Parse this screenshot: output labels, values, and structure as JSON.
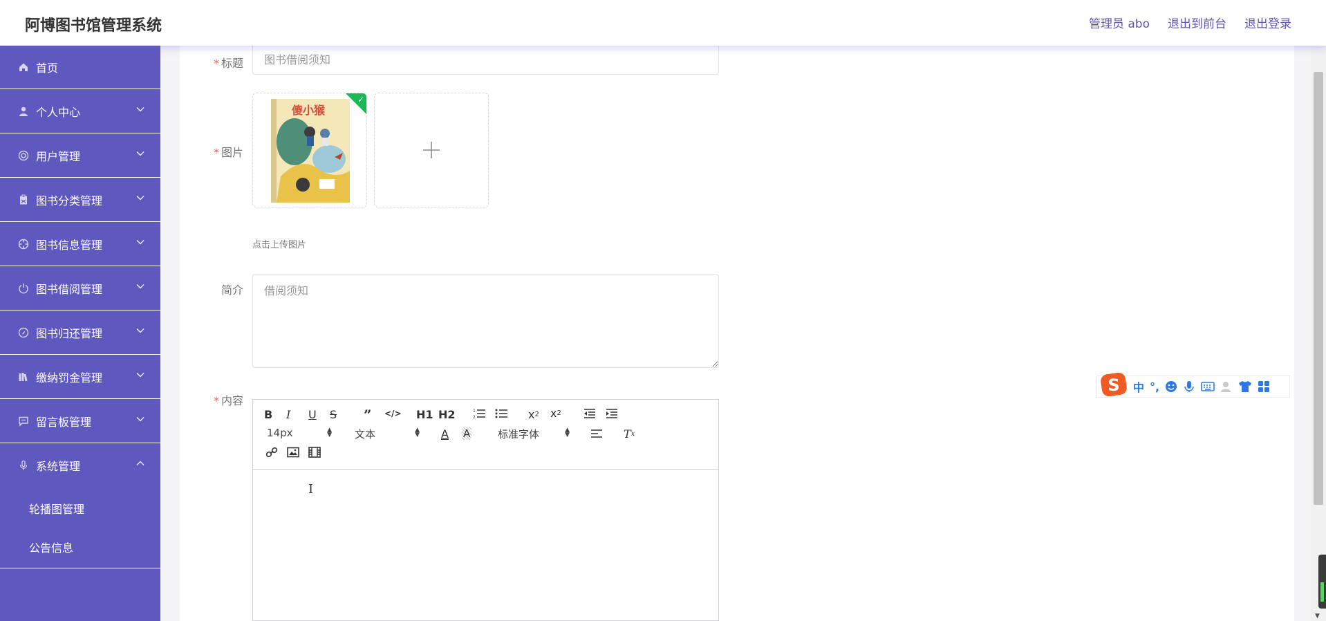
{
  "header": {
    "title": "阿博图书馆管理系统",
    "admin_label": "管理员 abo",
    "front_label": "退出到前台",
    "logout_label": "退出登录"
  },
  "sidebar": {
    "items": [
      {
        "label": "首页",
        "icon": "home-icon"
      },
      {
        "label": "个人中心",
        "icon": "user-icon"
      },
      {
        "label": "用户管理",
        "icon": "users-circle-icon"
      },
      {
        "label": "图书分类管理",
        "icon": "clipboard-icon"
      },
      {
        "label": "图书信息管理",
        "icon": "crosshair-icon"
      },
      {
        "label": "图书借阅管理",
        "icon": "power-icon"
      },
      {
        "label": "图书归还管理",
        "icon": "compass-icon"
      },
      {
        "label": "缴纳罚金管理",
        "icon": "books-icon"
      },
      {
        "label": "留言板管理",
        "icon": "message-icon"
      },
      {
        "label": "系统管理",
        "icon": "microphone-icon"
      }
    ],
    "sub_items": [
      {
        "label": "轮播图管理"
      },
      {
        "label": "公告信息"
      }
    ]
  },
  "form": {
    "title_label": "标题",
    "title_placeholder": "图书借阅须知",
    "image_label": "图片",
    "upload_hint": "点击上传图片",
    "intro_label": "简介",
    "intro_placeholder": "借阅须知",
    "content_label": "内容",
    "required_mark": "*"
  },
  "editor": {
    "font_size": "14px",
    "header_type": "文本",
    "font_family": "标准字体",
    "h1": "H1",
    "h2": "H2"
  },
  "book_cover": {
    "title": "傻小猴"
  },
  "ime": {
    "lang": "中",
    "punct": "°,"
  },
  "colors": {
    "sidebar_bg": "#5e58bf",
    "accent": "#5b56b8",
    "required": "#f05a5a",
    "upload_success": "#19b955"
  }
}
